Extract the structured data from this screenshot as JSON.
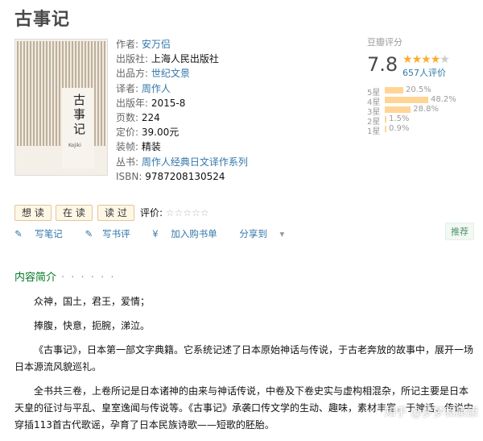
{
  "book": {
    "title": "古事记",
    "cover": {
      "title": "古事记",
      "subtitle": "Kojiki",
      "publisher": "上海人民出版社"
    },
    "info": [
      {
        "label": "作者:",
        "value": "安万侣",
        "link": true
      },
      {
        "label": "出版社:",
        "value": "上海人民出版社",
        "link": false
      },
      {
        "label": "出品方:",
        "value": "世纪文景",
        "link": true
      },
      {
        "label": "译者:",
        "value": "周作人",
        "link": true
      },
      {
        "label": "出版年:",
        "value": "2015-8",
        "link": false
      },
      {
        "label": "页数:",
        "value": "224",
        "link": false
      },
      {
        "label": "定价:",
        "value": "39.00元",
        "link": false
      },
      {
        "label": "装帧:",
        "value": "精装",
        "link": false
      },
      {
        "label": "丛书:",
        "value": "周作人经典日文译作系列",
        "link": true
      },
      {
        "label": "ISBN:",
        "value": "9787208130524",
        "link": false
      }
    ]
  },
  "rating": {
    "label": "豆瓣评分",
    "score": "7.8",
    "stars_filled": 4,
    "stars_total": 5,
    "count": "657人评价",
    "distribution": [
      {
        "star": "5星",
        "percent": "20.5%",
        "value": 20.5
      },
      {
        "star": "4星",
        "percent": "48.2%",
        "value": 48.2
      },
      {
        "star": "3星",
        "percent": "28.8%",
        "value": 28.8
      },
      {
        "star": "2星",
        "percent": "1.5%",
        "value": 1.5
      },
      {
        "star": "1星",
        "percent": "0.9%",
        "value": 0.9
      }
    ],
    "star_color": "#ffac2d",
    "bar_color": "#ffd596"
  },
  "buttons": {
    "want": "想 读",
    "reading": "在 读",
    "read": "读 过",
    "my_rating": "评价:"
  },
  "actions": {
    "write_note": "写笔记",
    "write_review": "写书评",
    "add_cart": "加入购书单",
    "share": "分享到"
  },
  "recommend": "推荐",
  "intro": {
    "heading": "内容简介",
    "dots": "· · · · · ·",
    "paragraphs": [
      "众神，国土，君王，爱情；",
      "捧腹，快意，扼腕，涕泣。",
      "《古事记》，日本第一部文字典籍。它系统记述了日本原始神话与传说，于古老奔放的故事中，展开一场日本源流风貌巡礼。",
      "全书共三卷，上卷所记是日本诸神的由来与神话传说，中卷及下卷史实与虚构相混杂，所记主要是日本天皇的征讨与平乱、皇室逸闻与传说等。《古事记》承袭口传文学的生动、趣味，素材丰富，于神话、传说中穿插113首古代歌谣，孕育了日本民族诗歌——短歌的胚胎。"
    ]
  },
  "watermark": "知乎 @梦梦和康康"
}
